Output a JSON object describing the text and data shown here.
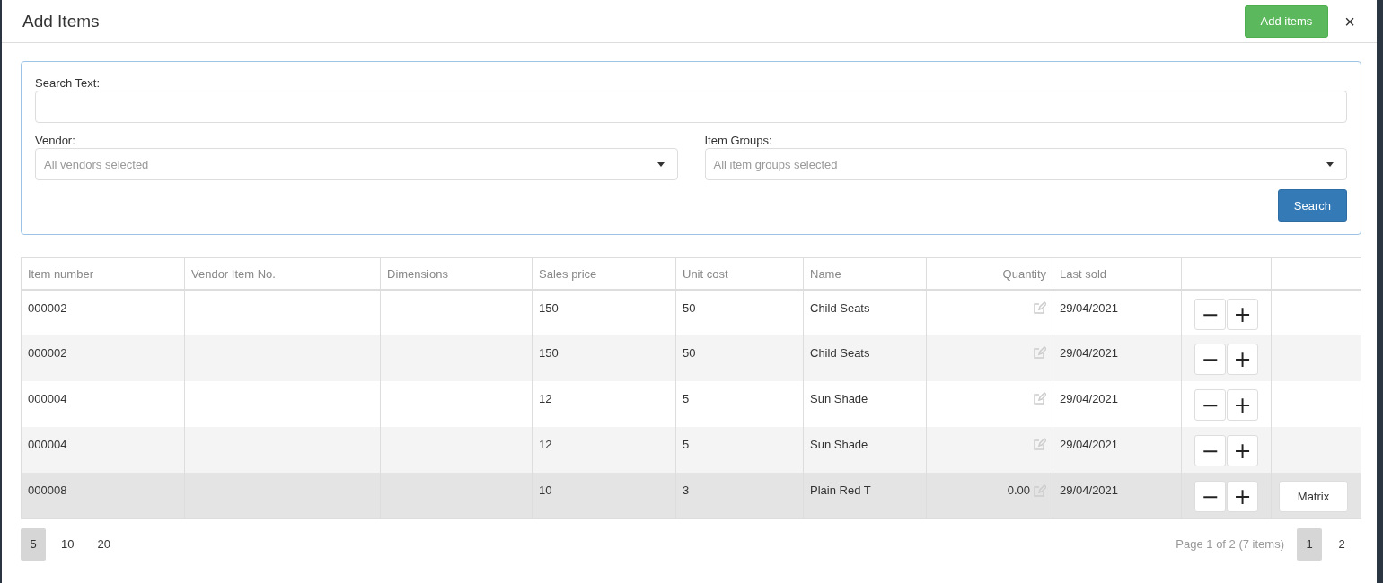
{
  "dialog": {
    "title": "Add Items",
    "add_button": "Add items",
    "close": "×"
  },
  "filters": {
    "search_label": "Search Text:",
    "vendor_label": "Vendor:",
    "vendor_value": "All vendors selected",
    "groups_label": "Item Groups:",
    "groups_value": "All item groups selected",
    "search_button": "Search"
  },
  "table": {
    "columns": [
      "Item number",
      "Vendor Item No.",
      "Dimensions",
      "Sales price",
      "Unit cost",
      "Name",
      "Quantity",
      "Last sold"
    ],
    "rows": [
      {
        "item_number": "000002",
        "sales_price": "150",
        "unit_cost": "50",
        "name": "Child Seats",
        "last_sold": "29/04/2021",
        "minus": "−",
        "plus": "+",
        "selected": false
      },
      {
        "item_number": "000002",
        "sales_price": "150",
        "unit_cost": "50",
        "name": "Child Seats",
        "last_sold": "29/04/2021",
        "minus": "−",
        "plus": "+",
        "selected": false
      },
      {
        "item_number": "000004",
        "sales_price": "12",
        "unit_cost": "5",
        "name": "Sun Shade",
        "last_sold": "29/04/2021",
        "minus": "−",
        "plus": "+",
        "selected": false
      },
      {
        "item_number": "000004",
        "sales_price": "12",
        "unit_cost": "5",
        "name": "Sun Shade",
        "last_sold": "29/04/2021",
        "minus": "−",
        "plus": "+",
        "selected": false
      },
      {
        "item_number": "000008",
        "sales_price": "10",
        "unit_cost": "3",
        "name": "Plain Red T",
        "quantity": "0.00",
        "last_sold": "29/04/2021",
        "minus": "−",
        "plus": "+",
        "matrix": "Matrix",
        "selected": true
      }
    ]
  },
  "pager": {
    "page_sizes": [
      {
        "label": "5",
        "selected": true
      },
      {
        "label": "10",
        "selected": false
      },
      {
        "label": "20",
        "selected": false
      }
    ],
    "summary": "Page 1 of 2 (7 items)",
    "pages": [
      {
        "label": "1",
        "selected": true
      },
      {
        "label": "2",
        "selected": false
      }
    ]
  }
}
